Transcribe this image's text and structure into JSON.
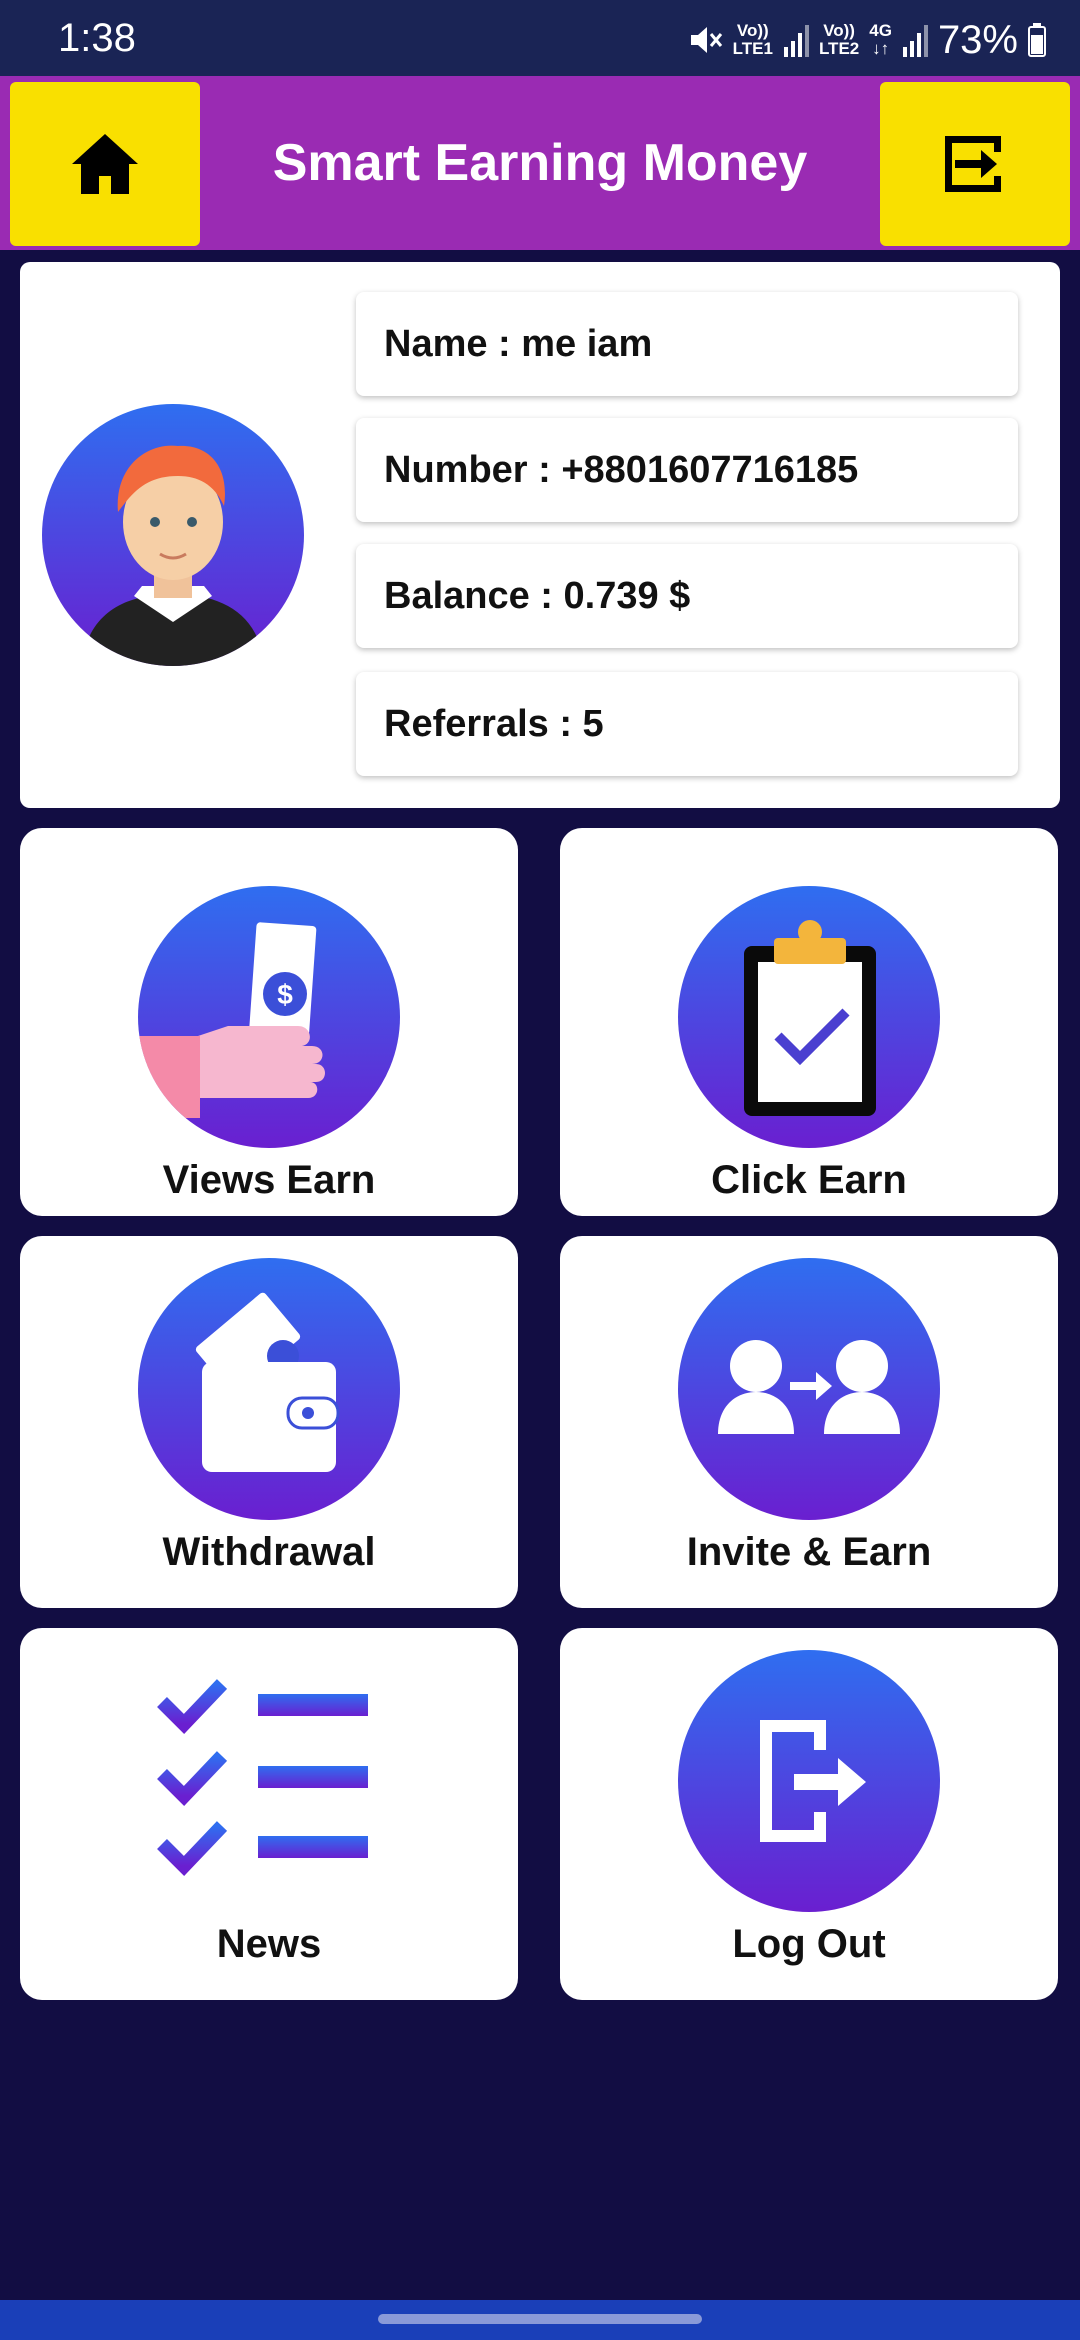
{
  "status": {
    "time": "1:38",
    "sim1": [
      "Vo))",
      "LTE1"
    ],
    "sim2": [
      "Vo))",
      "LTE2"
    ],
    "net_type": "4G",
    "battery": "73%"
  },
  "header": {
    "title": "Smart Earning Money",
    "home_icon": "home-icon",
    "exit_icon": "exit-icon",
    "button_color": "#f9e000",
    "bar_color": "#9a2bb3"
  },
  "profile": {
    "name": "Name : me iam",
    "number": "Number : +8801607716185",
    "balance": "Balance : 0.739 $",
    "referrals": "Referrals : 5"
  },
  "menu": {
    "views_earn": "Views Earn",
    "click_earn": "Click Earn",
    "withdrawal": "Withdrawal",
    "invite_earn": "Invite & Earn",
    "news": "News",
    "log_out": "Log Out"
  },
  "colors": {
    "background": "#120d43",
    "gradient_top": "#2f6ef0",
    "gradient_bottom": "#6a1fd0"
  }
}
